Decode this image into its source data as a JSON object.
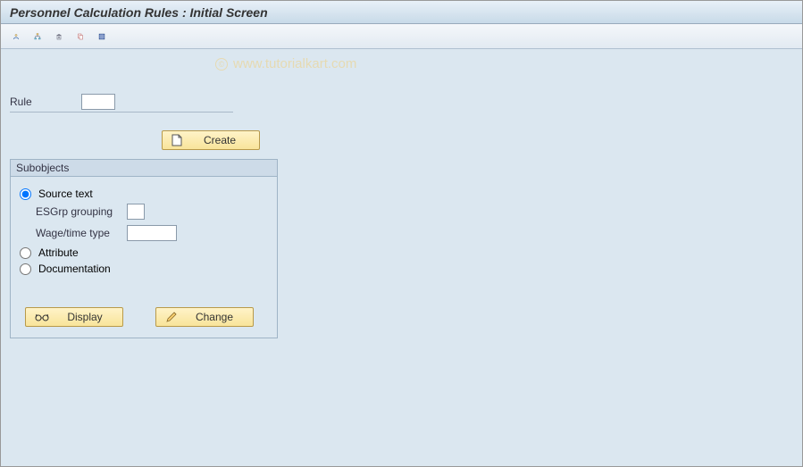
{
  "header": {
    "title": "Personnel Calculation Rules : Initial Screen"
  },
  "watermark": {
    "copyright": "©",
    "text": "www.tutorialkart.com"
  },
  "toolbar": {
    "icons": [
      "user-icon",
      "flow-icon",
      "trash-icon",
      "copy-icon",
      "grid-icon"
    ]
  },
  "main": {
    "rule_label": "Rule",
    "rule_value": "",
    "create_label": "Create"
  },
  "subobjects": {
    "title": "Subobjects",
    "options": {
      "source_text": {
        "label": "Source text",
        "selected": true
      },
      "attribute": {
        "label": "Attribute",
        "selected": false
      },
      "documentation": {
        "label": "Documentation",
        "selected": false
      }
    },
    "fields": {
      "esgrp_label": "ESGrp grouping",
      "esgrp_value": "",
      "wagetime_label": "Wage/time type",
      "wagetime_value": ""
    },
    "actions": {
      "display_label": "Display",
      "change_label": "Change"
    }
  }
}
